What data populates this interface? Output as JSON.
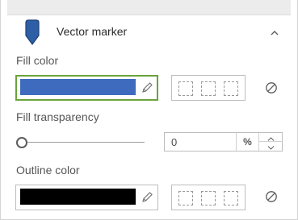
{
  "header": {
    "title": "Vector marker",
    "marker_color": "#2e5fa6"
  },
  "fill_color": {
    "label": "Fill color",
    "value": "#3e6bbd"
  },
  "fill_transparency": {
    "label": "Fill transparency",
    "value": "0",
    "unit": "%"
  },
  "outline_color": {
    "label": "Outline color",
    "value": "#000000"
  },
  "accent": "#6aa33a"
}
